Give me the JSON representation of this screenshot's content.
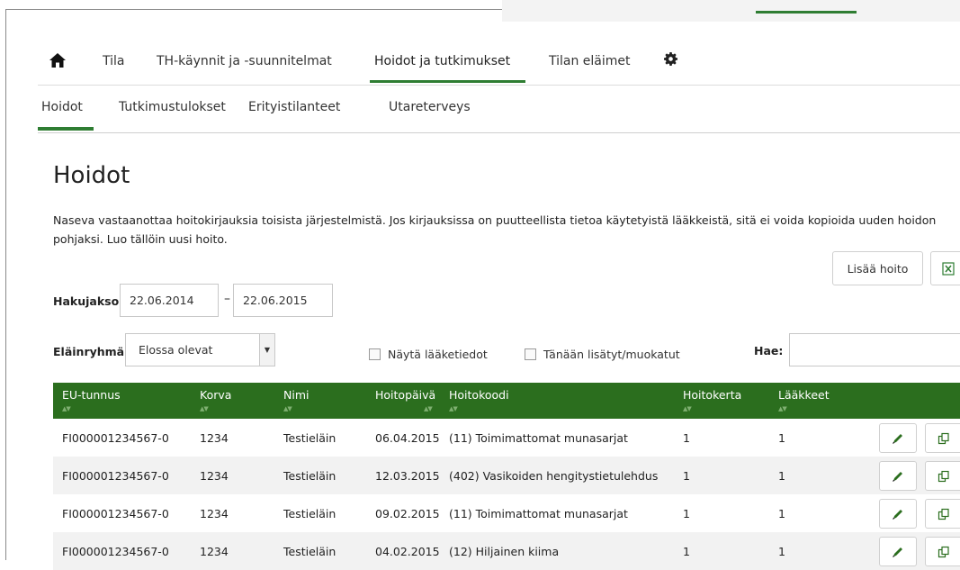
{
  "colors": {
    "accent": "#2e7d32",
    "header_bg": "#2b6e1e"
  },
  "nav": {
    "home_icon": "home-icon",
    "items": [
      "Tila",
      "TH-käynnit ja -suunnitelmat",
      "Hoidot ja tutkimukset",
      "Tilan eläimet"
    ],
    "settings_icon": "gear-icon",
    "active": "Hoidot ja tutkimukset"
  },
  "subnav": {
    "items": [
      "Hoidot",
      "Tutkimustulokset",
      "Erityistilanteet",
      "Utareterveys"
    ],
    "active": "Hoidot"
  },
  "page": {
    "title": "Hoidot",
    "description": "Naseva vastaanottaa hoitokirjauksia toisista järjestelmistä. Jos kirjauksissa on puutteellista tietoa käytetyistä lääkkeistä, sitä ei voida kopioida uuden hoidon pohjaksi. Luo tällöin uusi hoito."
  },
  "actions": {
    "add_label": "Lisää hoito",
    "export_icon": "excel-icon"
  },
  "filters": {
    "period_label": "Hakujakso",
    "from_date": "22.06.2014",
    "separator": "–",
    "to_date": "22.06.2015",
    "group_label": "Eläinryhmä",
    "group_value": "Elossa olevat",
    "show_meds_label": "Näytä lääketiedot",
    "today_label": "Tänään lisätyt/muokatut",
    "search_label": "Hae:",
    "search_value": ""
  },
  "table": {
    "columns": [
      "EU-tunnus",
      "Korva",
      "Nimi",
      "Hoitopäivä",
      "Hoitokoodi",
      "Hoitokerta",
      "Lääkkeet"
    ],
    "rows": [
      [
        "FI000001234567-0",
        "1234",
        "Testieläin",
        "06.04.2015",
        "(11) Toimimattomat munasarjat",
        "1",
        "1"
      ],
      [
        "FI000001234567-0",
        "1234",
        "Testieläin",
        "12.03.2015",
        "(402) Vasikoiden hengitystietulehdus",
        "1",
        "1"
      ],
      [
        "FI000001234567-0",
        "1234",
        "Testieläin",
        "09.02.2015",
        "(11) Toimimattomat munasarjat",
        "1",
        "1"
      ],
      [
        "FI000001234567-0",
        "1234",
        "Testieläin",
        "04.02.2015",
        "(12) Hiljainen kiima",
        "1",
        "1"
      ]
    ],
    "row_icons": [
      "edit-icon",
      "copy-icon"
    ]
  }
}
